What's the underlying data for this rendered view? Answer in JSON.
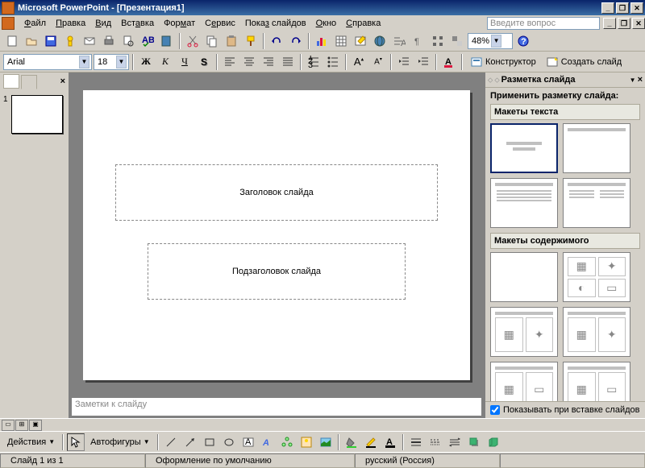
{
  "title": "Microsoft PowerPoint - [Презентация1]",
  "menu": [
    "Файл",
    "Правка",
    "Вид",
    "Вставка",
    "Формат",
    "Сервис",
    "Показ слайдов",
    "Окно",
    "Справка"
  ],
  "menu_u": [
    "Ф",
    "П",
    "В",
    "В",
    "Ф",
    "С",
    "П",
    "О",
    "С"
  ],
  "askbox": "Введите вопрос",
  "font": "Arial",
  "fontsize": "18",
  "zoom": "48%",
  "designer": "Конструктор",
  "newslide": "Создать слайд",
  "thumb_num": "1",
  "slide_title": "Заголовок слайда",
  "slide_sub": "Подзаголовок слайда",
  "notes": "Заметки к слайду",
  "tp_title": "Разметка слайда",
  "tp_apply": "Применить разметку слайда:",
  "tp_sect1": "Макеты текста",
  "tp_sect2": "Макеты содержимого",
  "tp_chk": "Показывать при вставке слайдов",
  "actions": "Действия",
  "autoshapes": "Автофигуры",
  "status_slide": "Слайд 1 из 1",
  "status_design": "Оформление по умолчанию",
  "status_lang": "русский (Россия)"
}
